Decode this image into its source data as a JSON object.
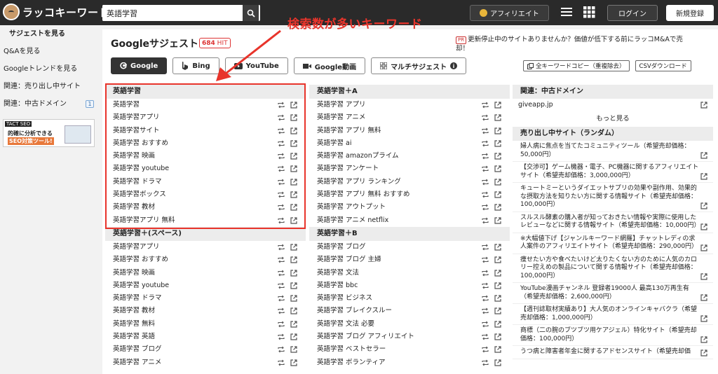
{
  "topbar": {
    "logo_text": "ラッコキーワード",
    "search_value": "英語学習",
    "affiliate_label": "アフィリエイト",
    "login_label": "ログイン",
    "signup_label": "新規登録"
  },
  "sidebar": {
    "items": [
      {
        "label": "サジェストを見る"
      },
      {
        "label": "Q&Aを見る"
      },
      {
        "label": "Googleトレンドを見る"
      },
      {
        "label": "関連：売り出し中サイト"
      },
      {
        "label": "関連：中古ドメイン",
        "badge": "1"
      }
    ],
    "banner": {
      "tag": "TACT SEO",
      "line1": "的確に分析できる",
      "line2": "SEO対策ツール!"
    }
  },
  "annotation": {
    "callout": "検索数が多いキーワード",
    "color": "#e8342b"
  },
  "main": {
    "title": "Googleサジェスト",
    "hit_count": "684",
    "hit_unit": "HIT",
    "notice_pr": "PR",
    "notice": "更新停止中のサイトありませんか？価値が低下する前にラッコM&Aで売却！",
    "tabs": [
      {
        "label": "Google",
        "icon": "google-icon"
      },
      {
        "label": "Bing",
        "icon": "bing-icon"
      },
      {
        "label": "YouTube",
        "icon": "youtube-icon"
      },
      {
        "label": "Google動画",
        "icon": "video-icon"
      },
      {
        "label": "マルチサジェスト",
        "icon": "grid-icon"
      }
    ],
    "copy_label": "全キーワードコピー（重複除去）",
    "csv_label": "CSVダウンロード"
  },
  "col1": {
    "sections": [
      {
        "title": "英語学習",
        "items": [
          "英語学習",
          "英語学習アプリ",
          "英語学習サイト",
          "英語学習 おすすめ",
          "英語学習 映画",
          "英語学習 youtube",
          "英語学習 ドラマ",
          "英語学習ボックス",
          "英語学習 教材",
          "英語学習アプリ 無料"
        ]
      },
      {
        "title": "英語学習＋(スペース)",
        "items": [
          "英語学習アプリ",
          "英語学習 おすすめ",
          "英語学習 映画",
          "英語学習 youtube",
          "英語学習 ドラマ",
          "英語学習 教材",
          "英語学習 無料",
          "英語学習 英語",
          "英語学習 ブログ",
          "英語学習 アニメ"
        ]
      }
    ]
  },
  "col2": {
    "sections": [
      {
        "title": "英語学習＋A",
        "items": [
          "英語学習 アプリ",
          "英語学習 アニメ",
          "英語学習 アプリ 無料",
          "英語学習 ai",
          "英語学習 amazonプライム",
          "英語学習 アンケート",
          "英語学習 アプリ ランキング",
          "英語学習 アプリ 無料 おすすめ",
          "英語学習 アウトプット",
          "英語学習 アニメ netflix"
        ]
      },
      {
        "title": "英語学習＋B",
        "items": [
          "英語学習 ブログ",
          "英語学習 ブログ 主婦",
          "英語学習 文法",
          "英語学習 bbc",
          "英語学習 ビジネス",
          "英語学習 ブレイクスルー",
          "英語学習 文法 必要",
          "英語学習 ブログ アフィリエイト",
          "英語学習 ベストセラー",
          "英語学習 ボランティア"
        ]
      }
    ]
  },
  "col3": {
    "domain_title": "関連：中古ドメイン",
    "domains": [
      "giveapp.jp"
    ],
    "more_label": "もっと見る",
    "sale_title": "売り出し中サイト（ランダム）",
    "sales": [
      "婦人病に焦点を当てたコミュニティツール（希望売却価格：50,000円）",
      "【交渉可】ゲーム機器・電子、PC機器に関するアフィリエイトサイト（希望売却価格：3,000,000円）",
      "キュートミーというダイエットサプリの効果や副作用、効果的な摂取方法を知りたい方に関する情報サイト（希望売却価格：100,000円）",
      "スルスル酵素の購入者が知っておきたい情報や実際に使用したレビューなどに関する情報サイト（希望売却価格：10,000円）",
      "※大幅値下げ【ジャンルキーワード網羅】チャットレディの求人案件のアフィリエイトサイト（希望売却価格：290,000円）",
      "痩せたい方や食べたいけど太りたくない方のために人気のカロリー控えめの製品について関する情報サイト（希望売却価格：100,000円）",
      "YouTube漫画チャンネル 登録者19000人 最高130万再生有（希望売却価格：2,600,000円）",
      "【週刊誌取材実績あり】大人気のオンラインキャバクラ（希望売却価格：1,000,000円）",
      "商標（二の腕のブツブツ用ケアジェル）特化サイト（希望売却価格：100,000円）",
      "うつ病と障害者年金に関するアドセンスサイト（希望売却価"
    ]
  }
}
